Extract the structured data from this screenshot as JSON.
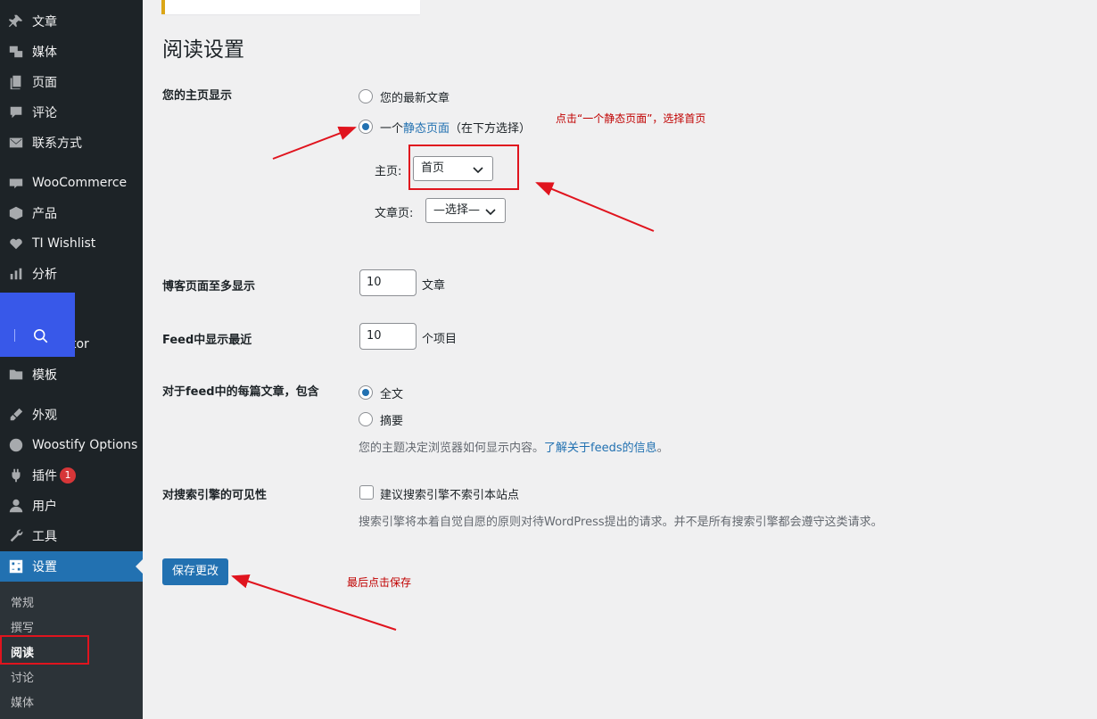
{
  "sidebar": {
    "items": [
      {
        "label": "文章",
        "icon": "pin-icon"
      },
      {
        "label": "媒体",
        "icon": "media-icon"
      },
      {
        "label": "页面",
        "icon": "page-icon"
      },
      {
        "label": "评论",
        "icon": "comment-icon"
      },
      {
        "label": "联系方式",
        "icon": "mail-icon"
      },
      {
        "label": "WooCommerce",
        "icon": "woo-icon"
      },
      {
        "label": "产品",
        "icon": "box-icon"
      },
      {
        "label": "TI Wishlist",
        "icon": "heart-icon"
      },
      {
        "label": "分析",
        "icon": "chart-icon"
      },
      {
        "label": "tor",
        "icon": ""
      },
      {
        "label": "模板",
        "icon": "folder-icon"
      },
      {
        "label": "外观",
        "icon": "brush-icon"
      },
      {
        "label": "Woostify Options",
        "icon": "woostify-icon"
      },
      {
        "label": "插件",
        "icon": "plugin-icon",
        "badge": "1"
      },
      {
        "label": "用户",
        "icon": "user-icon"
      },
      {
        "label": "工具",
        "icon": "wrench-icon"
      },
      {
        "label": "设置",
        "icon": "settings-icon"
      }
    ],
    "submenu": [
      "常规",
      "撰写",
      "阅读",
      "讨论",
      "媒体"
    ]
  },
  "page": {
    "title": "阅读设置",
    "homepage_display": {
      "label": "您的主页显示",
      "option_latest": "您的最新文章",
      "option_static_prefix": "一个",
      "option_static_link": "静态页面",
      "option_static_suffix": "（在下方选择）",
      "homepage_label": "主页:",
      "homepage_value": "首页",
      "posts_page_label": "文章页:",
      "posts_page_value": "—选择—"
    },
    "blog_pages": {
      "label": "博客页面至多显示",
      "value": "10",
      "unit": "文章"
    },
    "feed_recent": {
      "label": "Feed中显示最近",
      "value": "10",
      "unit": "个项目"
    },
    "feed_content": {
      "label": "对于feed中的每篇文章，包含",
      "option_full": "全文",
      "option_summary": "摘要",
      "desc_prefix": "您的主题决定浏览器如何显示内容。",
      "desc_link": "了解关于feeds的信息",
      "desc_suffix": "。"
    },
    "search_visibility": {
      "label": "对搜索引擎的可见性",
      "checkbox_label": "建议搜索引擎不索引本站点",
      "desc": "搜索引擎将本着自觉自愿的原则对待WordPress提出的请求。并不是所有搜索引擎都会遵守这类请求。"
    },
    "save_label": "保存更改"
  },
  "annotations": {
    "static_page_note": "点击“一个静态页面”，选择首页",
    "save_note": "最后点击保存"
  },
  "colors": {
    "sidebar_bg": "#1d2327",
    "accent": "#2271b1",
    "annotation_red": "#e0141e"
  }
}
